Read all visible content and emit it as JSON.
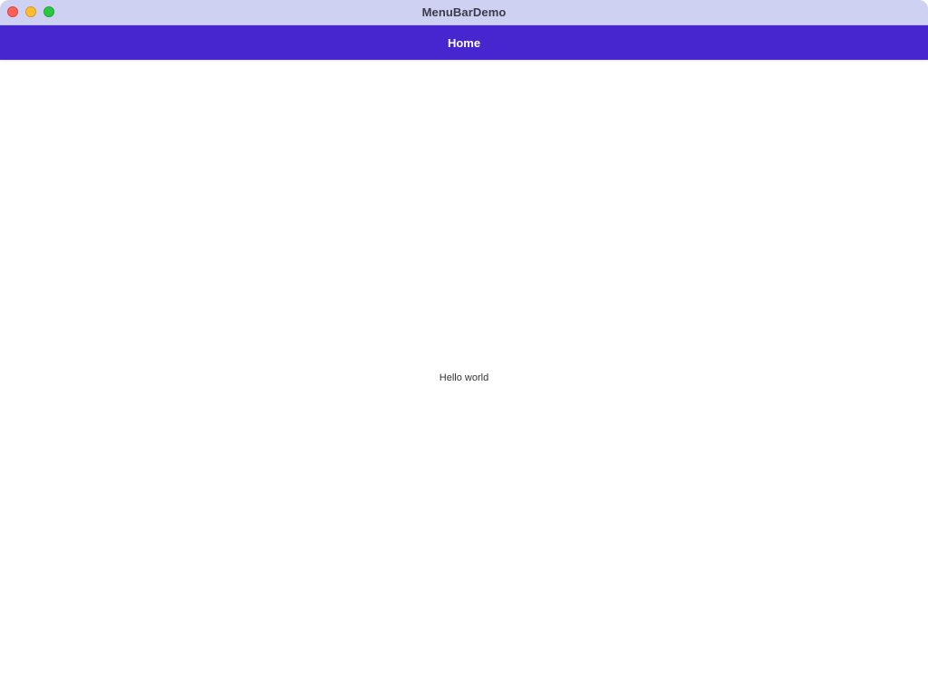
{
  "window": {
    "title": "MenuBarDemo",
    "colors": {
      "close": "#fe5f57",
      "minimize": "#febc2e",
      "maximize": "#28c840"
    }
  },
  "navbar": {
    "title": "Home",
    "color": "#4726cf"
  },
  "content": {
    "text": "Hello world"
  }
}
